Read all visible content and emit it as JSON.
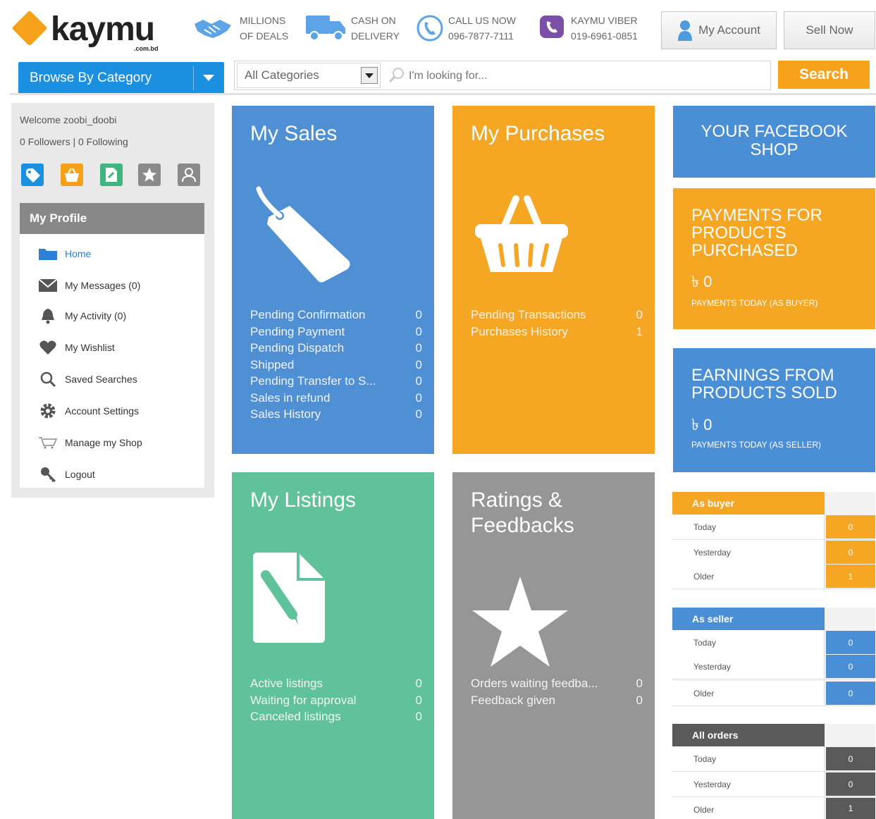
{
  "header": {
    "logo_text": "kaymu",
    "logo_tld": ".com.bd",
    "promos": [
      {
        "line1": "MILLIONS",
        "line2": "OF DEALS",
        "icon": "handshake-icon"
      },
      {
        "line1": "CASH ON",
        "line2": "DELIVERY",
        "icon": "truck-icon"
      },
      {
        "line1": "CALL US NOW",
        "line2": "096-7877-7111",
        "icon": "phone-icon"
      },
      {
        "line1": "KAYMU VIBER",
        "line2": "019-6961-0851",
        "icon": "viber-icon"
      }
    ],
    "my_account_label": "My Account",
    "sell_now_label": "Sell Now"
  },
  "nav": {
    "browse_label": "Browse By Category",
    "category_select": "All Categories",
    "search_placeholder": "I'm looking for...",
    "search_button": "Search"
  },
  "sidebar": {
    "welcome": "Welcome zoobi_doobi",
    "follow": "0 Followers | 0 Following",
    "quick_icons": [
      {
        "name": "tag-icon",
        "color": "#1b8fe0"
      },
      {
        "name": "basket-icon",
        "color": "#f5a11a"
      },
      {
        "name": "listing-icon",
        "color": "#3fb57f"
      },
      {
        "name": "star-icon",
        "color": "#8a8a8a"
      },
      {
        "name": "user-icon",
        "color": "#8a8a8a"
      }
    ],
    "profile_title": "My Profile",
    "menu": [
      {
        "label": "Home",
        "icon": "folder-icon"
      },
      {
        "label": "My Messages (0)",
        "icon": "envelope-icon"
      },
      {
        "label": "My Activity (0)",
        "icon": "bell-icon"
      },
      {
        "label": "My Wishlist",
        "icon": "heart-icon"
      },
      {
        "label": "Saved Searches",
        "icon": "magnifier-icon"
      },
      {
        "label": "Account Settings",
        "icon": "gear-icon"
      },
      {
        "label": "Manage my Shop",
        "icon": "cart-icon"
      },
      {
        "label": "Logout",
        "icon": "key-icon"
      }
    ]
  },
  "tiles": {
    "sales": {
      "title": "My Sales",
      "color": "#4f8fd3",
      "rows": [
        {
          "label": "Pending Confirmation",
          "value": "0"
        },
        {
          "label": "Pending Payment",
          "value": "0"
        },
        {
          "label": "Pending Dispatch",
          "value": "0"
        },
        {
          "label": "Shipped",
          "value": "0"
        },
        {
          "label": "Pending Transfer to S...",
          "value": "0"
        },
        {
          "label": "Sales in refund",
          "value": "0"
        },
        {
          "label": "Sales History",
          "value": "0"
        }
      ]
    },
    "purchases": {
      "title": "My Purchases",
      "color": "#f5a623",
      "rows": [
        {
          "label": "Pending Transactions",
          "value": "0"
        },
        {
          "label": "Purchases History",
          "value": "1"
        }
      ]
    },
    "listings": {
      "title": "My Listings",
      "color": "#5fc29a",
      "rows": [
        {
          "label": "Active listings",
          "value": "0"
        },
        {
          "label": "Waiting for approval",
          "value": "0"
        },
        {
          "label": "Canceled listings",
          "value": "0"
        }
      ]
    },
    "ratings": {
      "title_line1": "Ratings &",
      "title_line2": "Feedbacks",
      "color": "#969696",
      "rows": [
        {
          "label": "Orders waiting feedba...",
          "value": "0"
        },
        {
          "label": "Feedback given",
          "value": "0"
        }
      ]
    }
  },
  "right": {
    "facebook": {
      "line1": "YOUR FACEBOOK",
      "line2": "SHOP"
    },
    "payments": {
      "line1": "PAYMENTS FOR",
      "line2": "PRODUCTS",
      "line3": "PURCHASED",
      "amount": "৳ 0",
      "sub": "PAYMENTS TODAY (AS BUYER)"
    },
    "earnings": {
      "line1": "EARNINGS FROM",
      "line2": "PRODUCTS SOLD",
      "amount": "৳ 0",
      "sub": "PAYMENTS TODAY (AS SELLER)"
    },
    "tables": [
      {
        "title": "As buyer",
        "color": "#f5a623",
        "rows": [
          {
            "label": "Today",
            "value": "0"
          },
          {
            "label": "Yesterday",
            "value": "0"
          },
          {
            "label": "Older",
            "value": "1"
          }
        ]
      },
      {
        "title": "As seller",
        "color": "#4a8fd6",
        "rows": [
          {
            "label": "Today",
            "value": "0"
          },
          {
            "label": "Yesterday",
            "value": "0"
          },
          {
            "label": "Older",
            "value": "0"
          }
        ]
      },
      {
        "title": "All orders",
        "color": "#5a5a5a",
        "rows": [
          {
            "label": "Today",
            "value": "0"
          },
          {
            "label": "Yesterday",
            "value": "0"
          },
          {
            "label": "Older",
            "value": "1"
          }
        ]
      }
    ]
  }
}
